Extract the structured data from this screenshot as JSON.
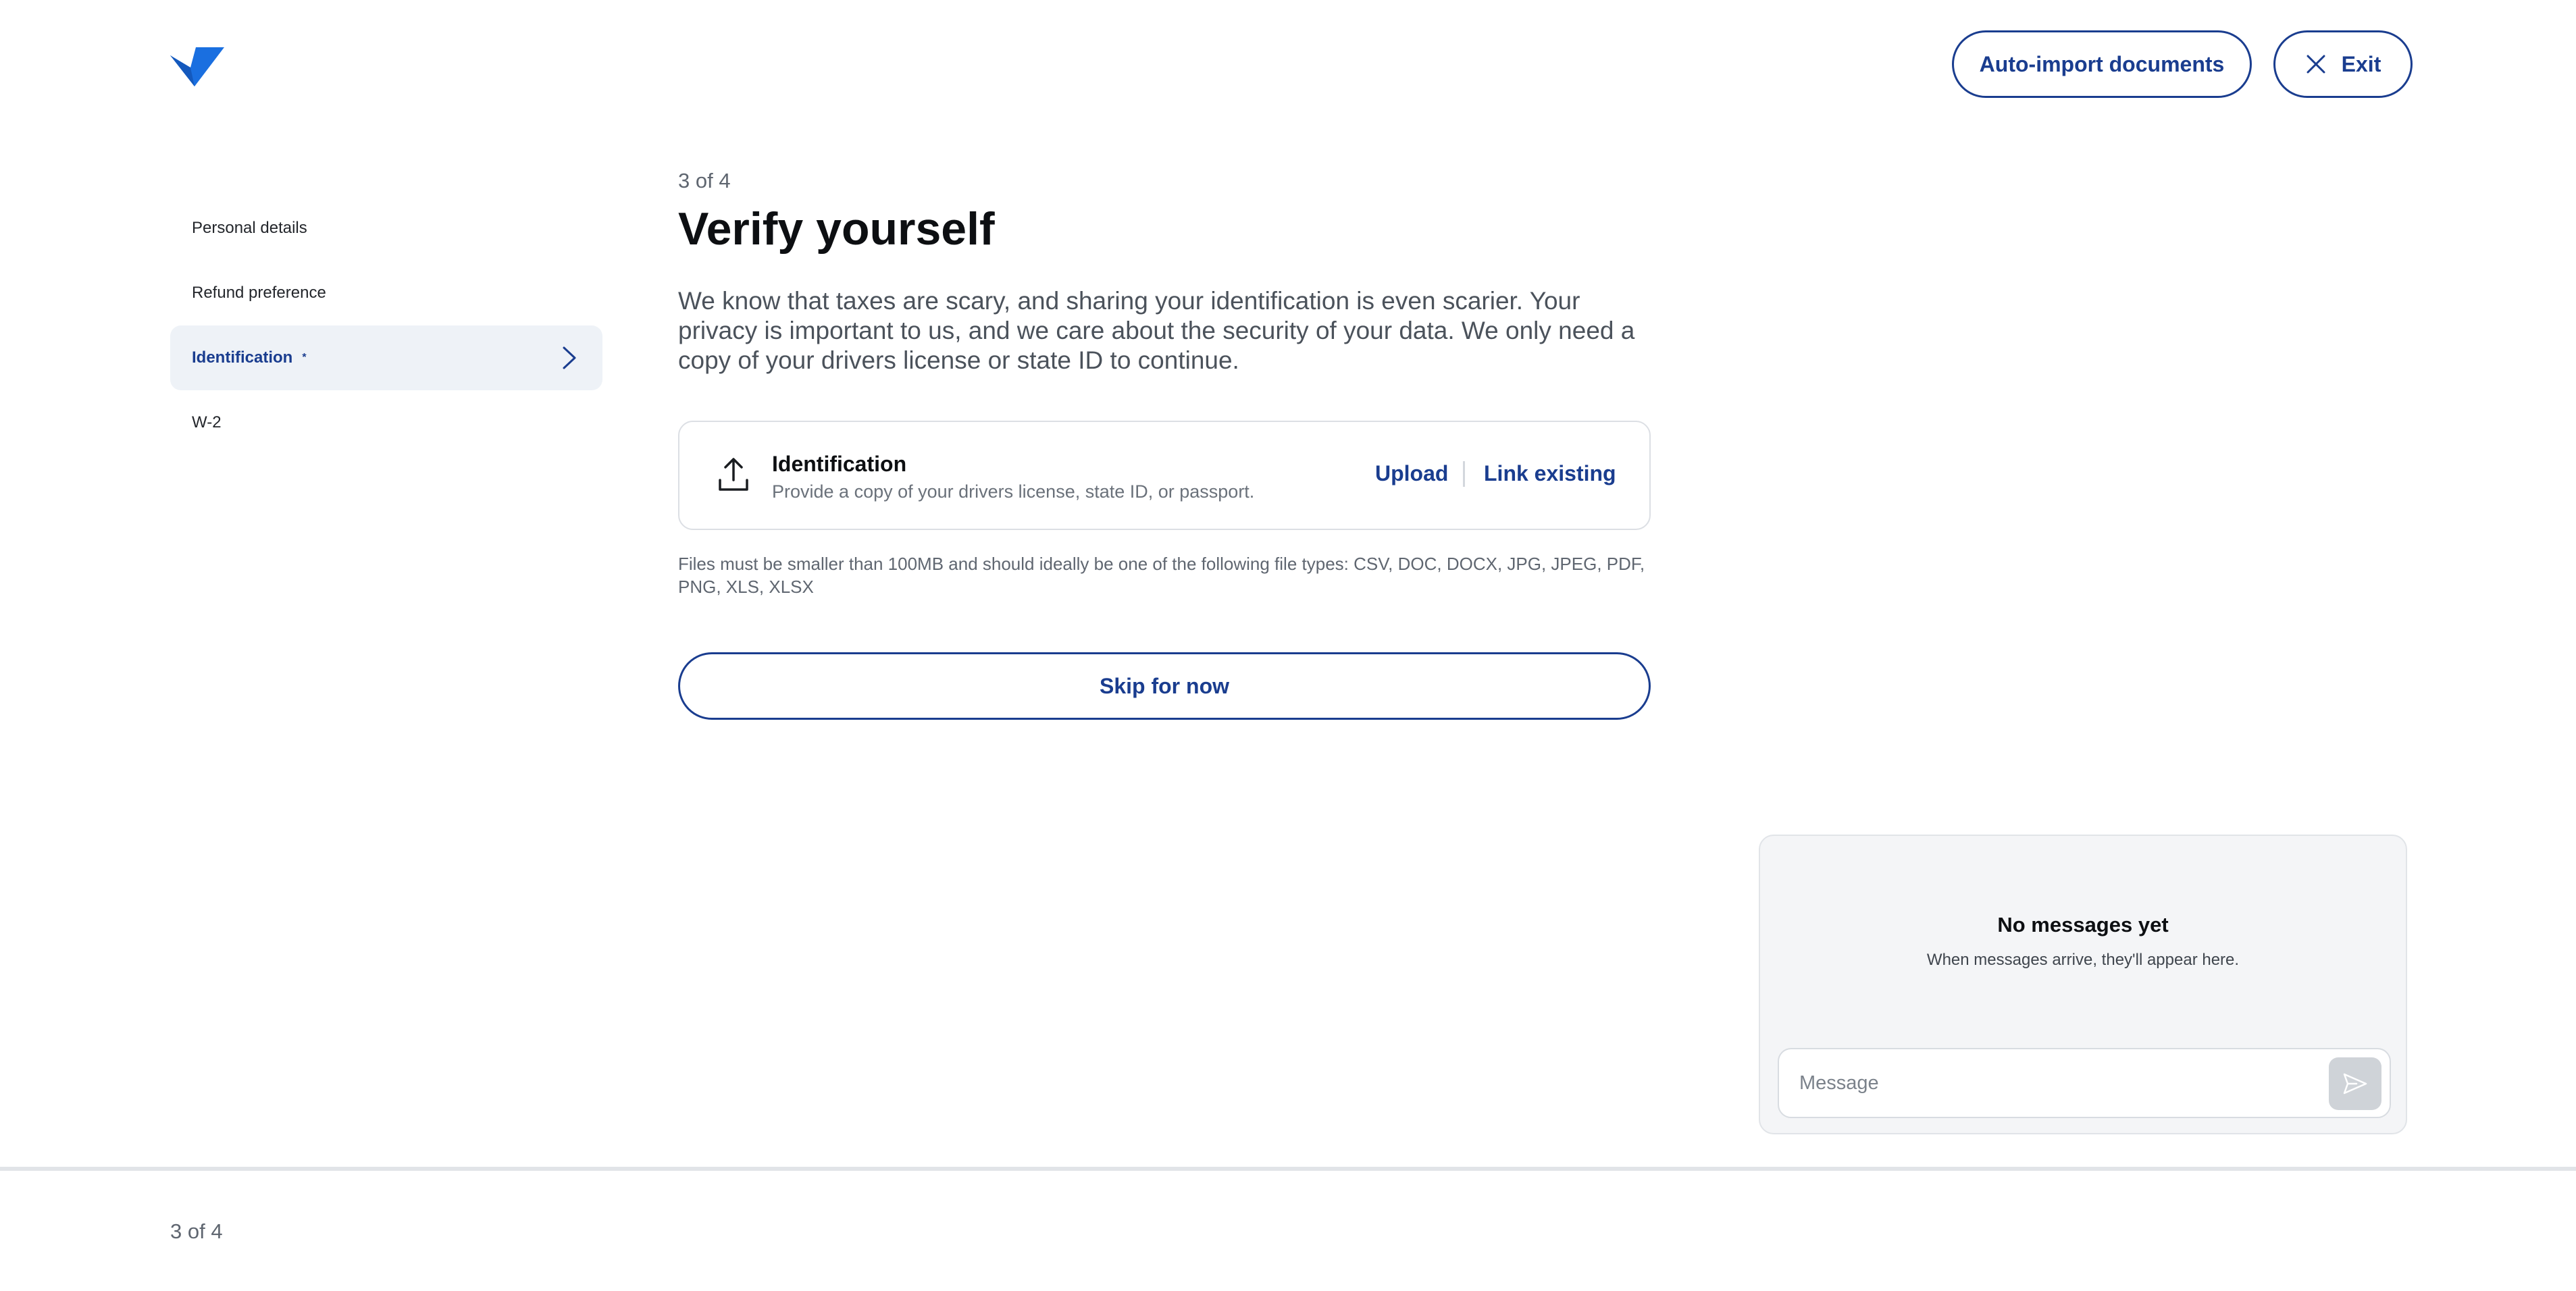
{
  "header": {
    "auto_import_label": "Auto-import documents",
    "exit_label": "Exit",
    "brand_color": "#1a6fe0",
    "accent_color": "#1a3d8f"
  },
  "sidebar": {
    "items": [
      {
        "label": "Personal details",
        "active": false
      },
      {
        "label": "Refund preference",
        "active": false
      },
      {
        "label": "Identification",
        "active": true,
        "marker": "*"
      },
      {
        "label": "W-2",
        "active": false
      }
    ]
  },
  "main": {
    "step": "3 of 4",
    "title": "Verify yourself",
    "description": "We know that taxes are scary, and sharing your identification is even scarier. Your privacy is important to us, and we care about the security of your data. We only need a copy of your drivers license or state ID to continue.",
    "upload_card": {
      "icon": "upload-icon",
      "title": "Identification",
      "subtitle": "Provide a copy of your drivers license, state ID, or passport.",
      "upload_label": "Upload",
      "link_label": "Link existing"
    },
    "file_note": "Files must be smaller than 100MB and should ideally be one of the following file types: CSV, DOC, DOCX, JPG, JPEG, PDF, PNG, XLS, XLSX",
    "skip_label": "Skip for now"
  },
  "messages": {
    "title": "No messages yet",
    "subtitle": "When messages arrive, they'll appear here.",
    "input_placeholder": "Message"
  },
  "footer": {
    "step": "3 of 4"
  }
}
